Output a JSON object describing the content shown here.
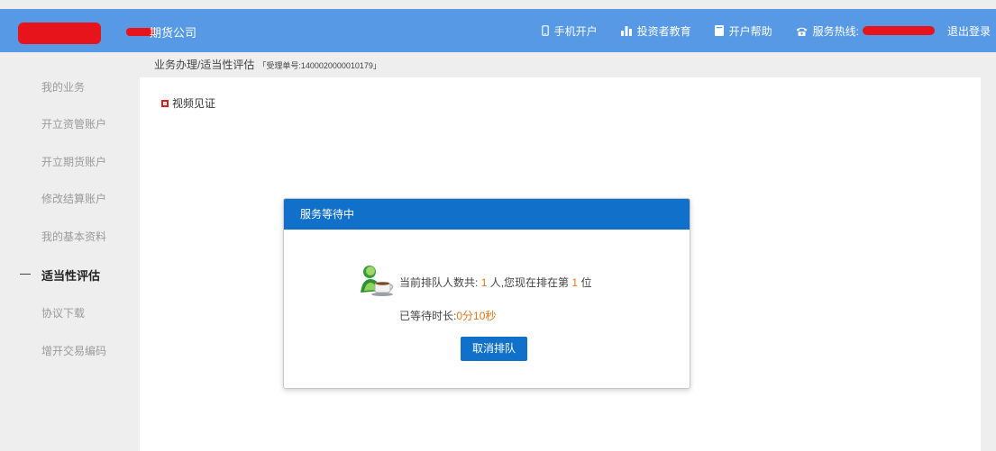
{
  "header": {
    "company_name": "期货公司",
    "nav": [
      {
        "icon": "phone-icon",
        "label": "手机开户"
      },
      {
        "icon": "chart-icon",
        "label": "投资者教育"
      },
      {
        "icon": "book-icon",
        "label": "开户帮助"
      },
      {
        "icon": "telephone-icon",
        "label": "服务热线:"
      }
    ],
    "logout": "退出登录",
    "colors": {
      "bar": "#5799e4",
      "redaction": "#e8141b"
    }
  },
  "sidebar": {
    "items": [
      {
        "label": "我的业务"
      },
      {
        "label": "开立资管账户"
      },
      {
        "label": "开立期货账户"
      },
      {
        "label": "修改结算账户"
      },
      {
        "label": "我的基本资料"
      },
      {
        "label": "适当性评估",
        "active": true
      },
      {
        "label": "协议下载"
      },
      {
        "label": "增开交易编码"
      }
    ]
  },
  "breadcrumb": {
    "path": "业务办理/适当性评估",
    "ticket": "「受理单号:1400020000010179」"
  },
  "content": {
    "section_label": "视频见证"
  },
  "modal": {
    "title": "服务等待中",
    "queue_prefix": "当前排队人数共:",
    "queue_count": "1",
    "queue_mid": "人,您现在排在第",
    "queue_position": "1",
    "queue_suffix": "位",
    "wait_label": "已等待时长:",
    "wait_value": "0分10秒",
    "cancel_label": "取消排队",
    "colors": {
      "header": "#1170c9",
      "highlight": "#e2761d"
    }
  }
}
